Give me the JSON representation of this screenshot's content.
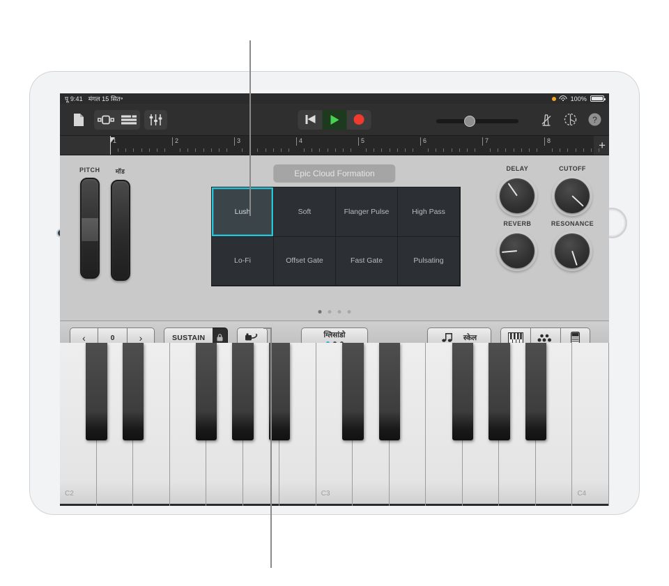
{
  "status_bar": {
    "time": "पू 9:41",
    "date": "मंगल 15 सित॰",
    "battery_percent": "100%",
    "wifi_icon": "wifi-icon",
    "recording_indicator_icon": "orange-dot-icon",
    "battery_icon": "battery-icon"
  },
  "toolbar": {
    "my_songs_icon": "document-icon",
    "instrument_view_icon": "instrument-view-icon",
    "tracks_view_icon": "tracks-view-icon",
    "mixer_icon": "faders-icon",
    "rewind_icon": "rewind-icon",
    "play_icon": "play-icon",
    "record_icon": "record-icon",
    "metronome_icon": "metronome-icon",
    "settings_icon": "gear-icon",
    "help_icon": "help-icon",
    "help_label": "?"
  },
  "ruler": {
    "bars": [
      "1",
      "2",
      "3",
      "4",
      "5",
      "6",
      "7",
      "8"
    ],
    "add_section_label": "+",
    "playhead_bar": "1"
  },
  "panel": {
    "patch_name": "Epic Cloud Formation",
    "wheels": [
      {
        "label": "PITCH",
        "name": "pitch-wheel"
      },
      {
        "label": "मॉड",
        "name": "mod-wheel"
      }
    ],
    "presets": [
      {
        "label": "Lush",
        "selected": true
      },
      {
        "label": "Soft",
        "selected": false
      },
      {
        "label": "Flanger Pulse",
        "selected": false
      },
      {
        "label": "High Pass",
        "selected": false
      },
      {
        "label": "Lo-Fi",
        "selected": false
      },
      {
        "label": "Offset Gate",
        "selected": false
      },
      {
        "label": "Fast Gate",
        "selected": false
      },
      {
        "label": "Pulsating",
        "selected": false
      }
    ],
    "page_dots": {
      "count": 4,
      "active_index": 0
    },
    "knobs": [
      {
        "label": "DELAY",
        "angle": -35
      },
      {
        "label": "CUTOFF",
        "angle": 133
      },
      {
        "label": "REVERB",
        "angle": -95
      },
      {
        "label": "RESONANCE",
        "angle": 162
      }
    ],
    "selection_color": "#26c6da"
  },
  "control_bar": {
    "octave_down_label": "‹",
    "octave_value": "0",
    "octave_up_label": "›",
    "sustain_label": "SUSTAIN",
    "lock_icon": "lock-icon",
    "arpeggiator_icon": "arpeggiator-icon",
    "glissando_label": "ग्लिसांडो",
    "glissando_dots": {
      "count": 3,
      "active_index": 0
    },
    "scale_label": "स्केल",
    "scale_icon": "double-note-icon",
    "keyboard_layout_icon": "piano-keys-icon",
    "chord_strips_icon": "notes-chord-icon",
    "fader_strip_icon": "fader-strip-icon"
  },
  "keyboard": {
    "octave_labels": [
      "C2",
      "C3",
      "C4"
    ],
    "white_key_count": 15,
    "start_note": "C2"
  }
}
